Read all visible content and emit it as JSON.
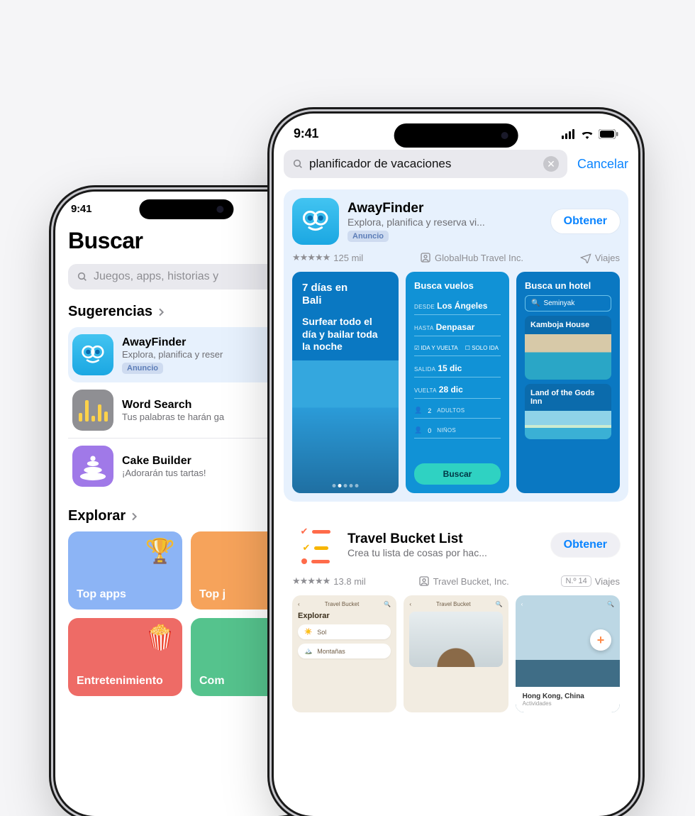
{
  "status": {
    "time": "9:41"
  },
  "back": {
    "title": "Buscar",
    "search_placeholder": "Juegos, apps, historias y",
    "suggestions": {
      "header": "Sugerencias",
      "items": [
        {
          "name": "AwayFinder",
          "sub": "Explora, planifica y reser",
          "ad_badge": "Anuncio"
        },
        {
          "name": "Word Search",
          "sub": "Tus palabras te harán ga"
        },
        {
          "name": "Cake Builder",
          "sub": "¡Adorarán tus tartas!"
        }
      ]
    },
    "explore": {
      "header": "Explorar",
      "cards": [
        {
          "label": "Top apps",
          "bg": "#8cb4f5",
          "deco": "🏆"
        },
        {
          "label": "Top j",
          "bg": "#f6a35b",
          "deco": ""
        },
        {
          "label": "Entretenimiento",
          "bg": "#ee6b66",
          "deco": "🍿"
        },
        {
          "label": "Com",
          "bg": "#55c38d",
          "deco": ""
        }
      ]
    }
  },
  "front": {
    "search_value": "planificador de vacaciones",
    "cancel": "Cancelar",
    "results": [
      {
        "ad": true,
        "name": "AwayFinder",
        "sub": "Explora, planifica y reserva vi...",
        "ad_badge": "Anuncio",
        "get": "Obtener",
        "ratings": "125 mil",
        "developer": "GlobalHub Travel Inc.",
        "category": "Viajes",
        "shot1": {
          "headline_l1": "7 días en",
          "headline_l2": "Bali",
          "sub": "Surfear todo el día y bailar toda la noche"
        },
        "shot2": {
          "title": "Busca vuelos",
          "from_label": "DESDE",
          "from": "Los Ángeles",
          "to_label": "HASTA",
          "to": "Denpasar",
          "roundtrip": "IDA Y VUELTA",
          "oneway": "SOLO IDA",
          "dep_label": "SALIDA",
          "dep": "15 dic",
          "ret_label": "VUELTA",
          "ret": "28 dic",
          "adults_n": "2",
          "adults": "ADULTOS",
          "kids_n": "0",
          "kids": "NIÑOS",
          "btn": "Buscar"
        },
        "shot3": {
          "title": "Busca un hotel",
          "query": "Seminyak",
          "hotel1": "Kamboja House",
          "hotel2": "Land of the Gods Inn"
        }
      },
      {
        "ad": false,
        "name": "Travel Bucket List",
        "sub": "Crea tu lista de cosas por hac...",
        "get": "Obtener",
        "ratings": "13.8 mil",
        "developer": "Travel Bucket, Inc.",
        "rank": "N.º 14",
        "category": "Viajes",
        "shota": {
          "brand": "Travel Bucket",
          "header": "Explorar",
          "pill1": "Sol",
          "pill2": "Montañas"
        },
        "shotb": {
          "brand": "Travel Bucket"
        },
        "shotc": {
          "title": "Hong Kong, China",
          "sub": "Actividades"
        }
      }
    ]
  }
}
